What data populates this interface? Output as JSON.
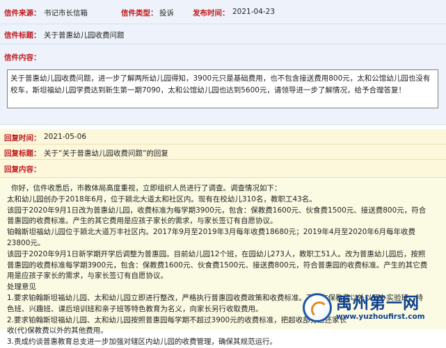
{
  "letter": {
    "source_label": "信件来源：",
    "source_value": "书记市长信箱",
    "type_label": "信件类型：",
    "type_value": "投诉",
    "date_label": "发布时间：",
    "date_value": "2021-04-23",
    "title_label": "信件标题：",
    "title_value": "关于普惠幼儿园收费问题",
    "content_label": "信件内容：",
    "content_lines": [
      "关于普惠幼儿园收费问题，进一步了解两所幼儿园得知，3900元只是基础费用，也不包含接送费用800元，太和公馆幼儿园也没有",
      "校车，斯坦福幼儿园学费达到新生第一期7090，太和公馆幼儿园也达到5600元，请领导进一步了解情况，给予合理答复！"
    ]
  },
  "reply": {
    "time_label": "回复时间：",
    "time_value": "2021-05-06",
    "title_label": "回复标题：",
    "title_value": "关于“关于普惠幼儿园收费问题”的回复",
    "content_label": "回复内容：",
    "content_lines": [
      "你好，信件收悉后，市教体局高度重视，立即组织人员进行了调查。调查情况如下：",
      "太和幼儿园创办于2018年6月，位于颍北大道太和社区内。现有在校幼儿310名，教职工43名。",
      "该园于2020年9月1日改为普惠幼儿园，收费标准为每学期3900元，包含：保教费1600元、伙食费1500元、接送费800元，符合",
      "普惠园的收费标准。产生的其它费用是应孩子家长的需求，与家长签订有自愿协议。",
      "铂翰斯坦福幼儿园位于颍北大道万丰社区内。2017年9月至2019年3月每年收费18680元；2019年4月至2020年6月每年收费",
      "23800元。",
      "该园于2020年9月1日新学期开学后调整为普惠园。目前幼儿园12个班，在园幼儿273人，教职工51人。改为普惠幼儿园后，按照",
      "普惠园的收费标准每学期3900元，包含：保教费1600元、伙食费1500元、接送费800元，符合普惠园的收费标准。产生的其它费",
      "用是应孩子家长的需求，与家长签订有自愿协议。",
      "处理意见",
      "1.要求铂翰斯坦福幼儿园、太和幼儿园立即进行整改，严格执行普惠园收费政策和收费标准。不得在保教费以外以开办实验班、特",
      "色班、兴趣班、课后培训班和亲子班等特色教育为名义，向家长另行收取费用。",
      "2.要求铂翰斯坦福幼儿园、太和幼儿园按照普惠园每学期不超过3900元的收费标准，把超收部分退还家长",
      "收(代)保教费以外的其他费用。",
      "3.责成约谈普惠教育总支进一步加强对辖区内幼儿园的收费管理，确保其规范运行。"
    ]
  },
  "watermark": {
    "brand": "禹州第一网",
    "url": "www.yuzhoufirst.com"
  },
  "colors": {
    "label_red": "#c0161b",
    "letter_bg": "#eef3fb",
    "reply_bg": "#fdf7dc",
    "reply_body_bg": "#fbfbe3",
    "watermark_blue": "#0d3f8c"
  }
}
